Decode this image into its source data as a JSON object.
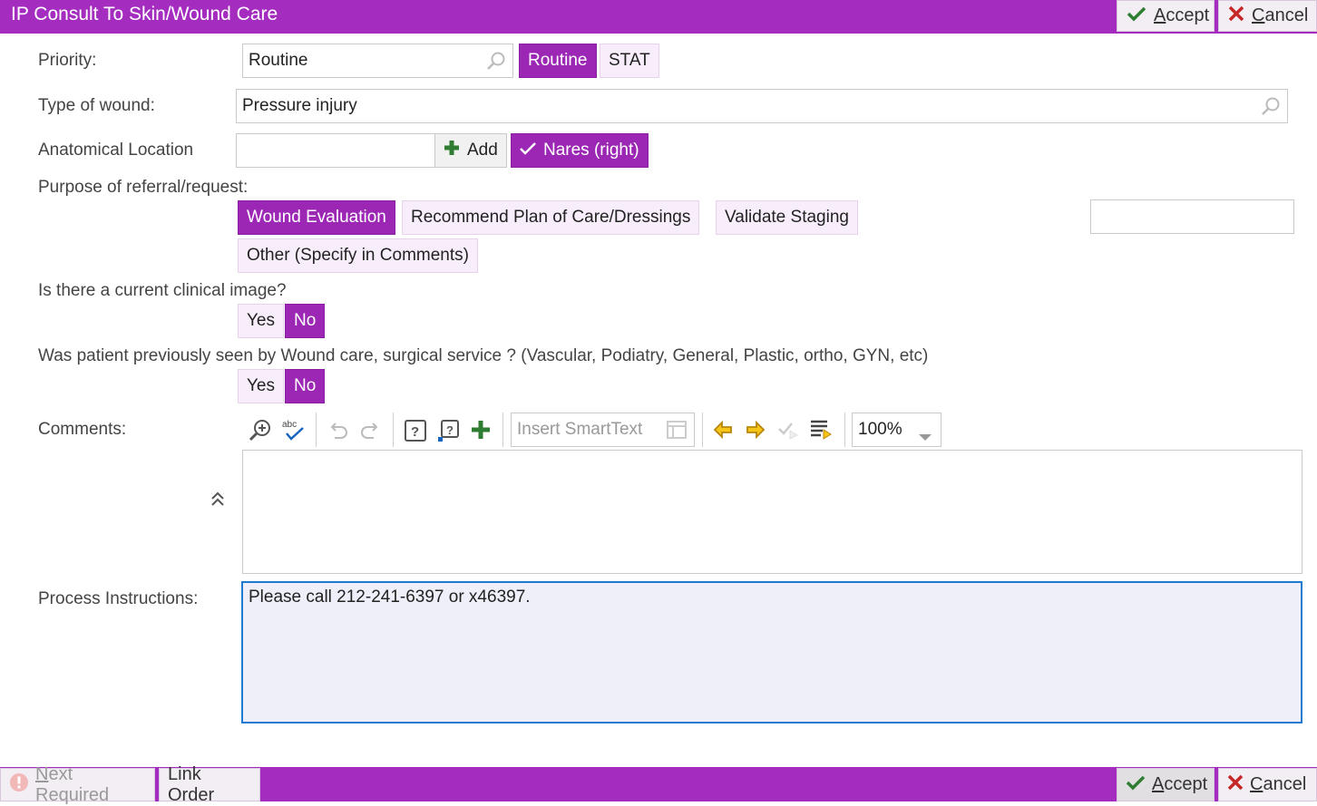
{
  "window": {
    "title": "IP Consult To Skin/Wound Care"
  },
  "header": {
    "accept_label": "ccept",
    "accept_key": "A",
    "cancel_label": "ancel",
    "cancel_key": "C"
  },
  "priority": {
    "label": "Priority:",
    "value": "Routine",
    "options": [
      "Routine",
      "STAT"
    ],
    "selected": "Routine"
  },
  "wound_type": {
    "label": "Type of wound:",
    "value": "Pressure injury"
  },
  "location": {
    "label": "Anatomical Location",
    "value": "",
    "add_label": "Add",
    "chip": "Nares (right)"
  },
  "purpose": {
    "label": "Purpose of referral/request:",
    "options": [
      "Wound Evaluation",
      "Recommend Plan of Care/Dressings",
      "Validate Staging",
      "Other (Specify in Comments)"
    ],
    "selected": "Wound Evaluation",
    "other_value": ""
  },
  "clinical_image": {
    "label": "Is there a current clinical image?",
    "yes": "Yes",
    "no": "No",
    "selected": "No"
  },
  "seen_before": {
    "label": "Was patient previously seen by Wound care, surgical service ? (Vascular, Podiatry, General, Plastic, ortho, GYN, etc)",
    "yes": "Yes",
    "no": "No",
    "selected": "No"
  },
  "comments": {
    "label": "Comments:",
    "smarttext_placeholder": "Insert SmartText",
    "zoom": "100%",
    "value": ""
  },
  "process": {
    "label": "Process Instructions:",
    "value": "Please call 212-241-6397 or x46397."
  },
  "footer": {
    "next_required": "ext Required",
    "next_key": "N",
    "link_order": "Link Order",
    "accept_label": "ccept",
    "accept_key": "A",
    "cancel_label": "ancel",
    "cancel_key": "C"
  },
  "colors": {
    "accent": "#a42cbf",
    "selected": "#9c27b5",
    "pill_bg": "#f8eefb",
    "green": "#2e7d32"
  }
}
